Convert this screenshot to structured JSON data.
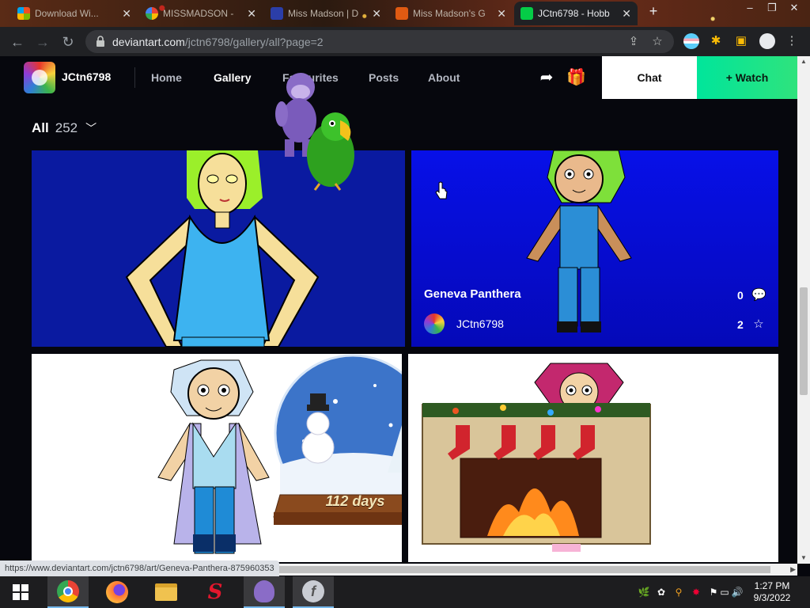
{
  "browser": {
    "tabs": [
      {
        "title": "Download Wi...",
        "icon": "windows-icon",
        "active": false
      },
      {
        "title": "MISSMADSON -",
        "icon": "google-icon",
        "active": false
      },
      {
        "title": "Miss Madson | D",
        "icon": "site-icon",
        "active": false
      },
      {
        "title": "Miss Madson's G",
        "icon": "dg-icon",
        "active": false
      },
      {
        "title": "JCtn6798 - Hobb",
        "icon": "deviantart-icon",
        "active": true
      }
    ],
    "url_host": "deviantart.com",
    "url_path": "/jctn6798/gallery/all?page=2"
  },
  "site": {
    "username": "JCtn6798",
    "nav": [
      "Home",
      "Gallery",
      "Favourites",
      "Posts",
      "About"
    ],
    "chat_label": "Chat",
    "watch_label": "+ Watch"
  },
  "gallery": {
    "filter_label": "All",
    "count": "252",
    "featured": {
      "title": "Geneva Panthera",
      "author": "JCtn6798",
      "comments": "0",
      "favourites": "2"
    }
  },
  "snowglobe_text": "112 days",
  "status_url": "https://www.deviantart.com/jctn6798/art/Geneva-Panthera-875960353",
  "clock": {
    "time": "1:27 PM",
    "date": "9/3/2022"
  },
  "colors": {
    "watch": "#00e59b",
    "accent_blue": "#0710e8"
  }
}
